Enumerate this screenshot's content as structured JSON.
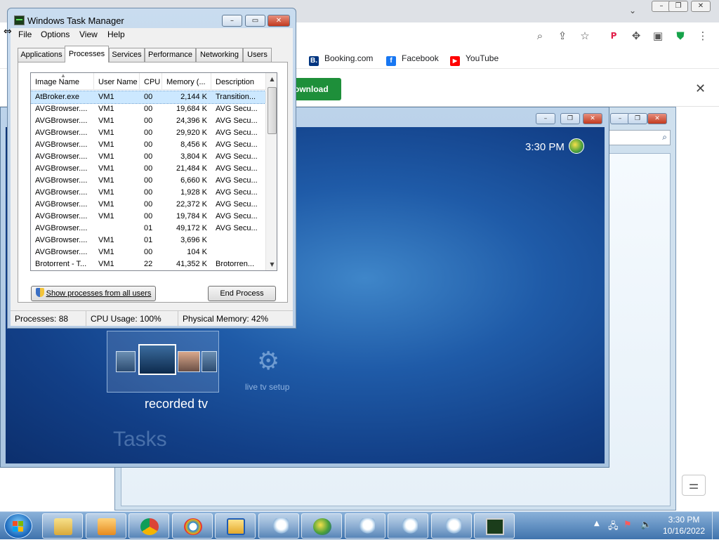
{
  "browser": {
    "bookmarks": [
      {
        "label": "Booking.com",
        "icon": "booking-icon",
        "color": "#003580",
        "glyph": "B."
      },
      {
        "label": "Facebook",
        "icon": "facebook-icon",
        "color": "#1877f2",
        "glyph": "f"
      },
      {
        "label": "YouTube",
        "icon": "youtube-icon",
        "color": "#ff0000",
        "glyph": "▶"
      }
    ],
    "download_label": "ownload"
  },
  "media_center": {
    "clock": "3:30 PM",
    "recorded_tv_label": "recorded tv",
    "live_tv_setup_label": "live tv setup",
    "tasks_label": "Tasks"
  },
  "task_manager": {
    "title": "Windows Task Manager",
    "menu": [
      "File",
      "Options",
      "View",
      "Help"
    ],
    "tabs": [
      "Applications",
      "Processes",
      "Services",
      "Performance",
      "Networking",
      "Users"
    ],
    "active_tab": "Processes",
    "columns": [
      "Image Name",
      "User Name",
      "CPU",
      "Memory (...",
      "Description"
    ],
    "rows": [
      {
        "image": "AtBroker.exe",
        "user": "VM1",
        "cpu": "00",
        "mem": "2,144 K",
        "desc": "Transition..."
      },
      {
        "image": "AVGBrowser....",
        "user": "VM1",
        "cpu": "00",
        "mem": "19,684 K",
        "desc": "AVG Secu..."
      },
      {
        "image": "AVGBrowser....",
        "user": "VM1",
        "cpu": "00",
        "mem": "24,396 K",
        "desc": "AVG Secu..."
      },
      {
        "image": "AVGBrowser....",
        "user": "VM1",
        "cpu": "00",
        "mem": "29,920 K",
        "desc": "AVG Secu..."
      },
      {
        "image": "AVGBrowser....",
        "user": "VM1",
        "cpu": "00",
        "mem": "8,456 K",
        "desc": "AVG Secu..."
      },
      {
        "image": "AVGBrowser....",
        "user": "VM1",
        "cpu": "00",
        "mem": "3,804 K",
        "desc": "AVG Secu..."
      },
      {
        "image": "AVGBrowser....",
        "user": "VM1",
        "cpu": "00",
        "mem": "21,484 K",
        "desc": "AVG Secu..."
      },
      {
        "image": "AVGBrowser....",
        "user": "VM1",
        "cpu": "00",
        "mem": "6,660 K",
        "desc": "AVG Secu..."
      },
      {
        "image": "AVGBrowser....",
        "user": "VM1",
        "cpu": "00",
        "mem": "1,928 K",
        "desc": "AVG Secu..."
      },
      {
        "image": "AVGBrowser....",
        "user": "VM1",
        "cpu": "00",
        "mem": "22,372 K",
        "desc": "AVG Secu..."
      },
      {
        "image": "AVGBrowser....",
        "user": "VM1",
        "cpu": "00",
        "mem": "19,784 K",
        "desc": "AVG Secu..."
      },
      {
        "image": "AVGBrowser....",
        "user": "",
        "cpu": "01",
        "mem": "49,172 K",
        "desc": "AVG Secu..."
      },
      {
        "image": "AVGBrowser....",
        "user": "VM1",
        "cpu": "01",
        "mem": "3,696 K",
        "desc": ""
      },
      {
        "image": "AVGBrowser....",
        "user": "VM1",
        "cpu": "00",
        "mem": "104 K",
        "desc": ""
      },
      {
        "image": "Brotorrent - T...",
        "user": "VM1",
        "cpu": "22",
        "mem": "41,352 K",
        "desc": "Brotorren..."
      }
    ],
    "show_all_button": "Show processes from all users",
    "end_process_button": "End Process",
    "status": {
      "processes": "Processes: 88",
      "cpu": "CPU Usage: 100%",
      "memory": "Physical Memory: 42%"
    }
  },
  "taskbar": {
    "items": [
      "file-explorer-icon",
      "media-player-icon",
      "chrome-icon",
      "app-icon",
      "window-app-icon",
      "search-magnifier-icon",
      "windows-media-center-icon",
      "search-magnifier-icon",
      "search-magnifier-icon",
      "search-magnifier-icon",
      "task-manager-icon"
    ],
    "time": "3:30 PM",
    "date": "10/16/2022"
  }
}
